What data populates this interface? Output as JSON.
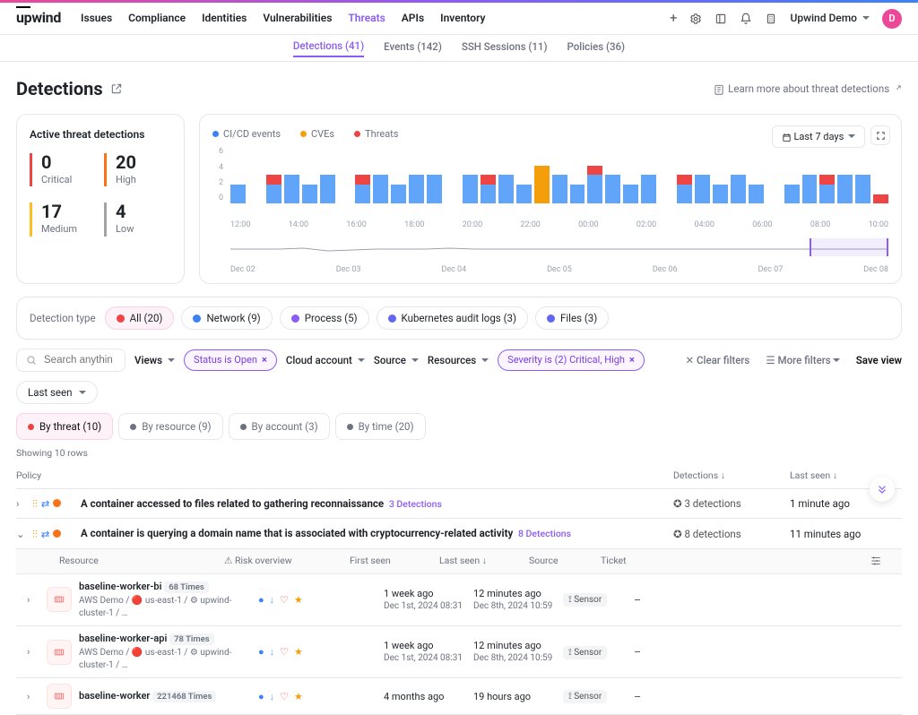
{
  "brand": "upwind",
  "nav": [
    "Issues",
    "Compliance",
    "Identities",
    "Vulnerabilities",
    "Threats",
    "APIs",
    "Inventory"
  ],
  "nav_active": 4,
  "workspace": {
    "name": "Upwind Demo",
    "avatar": "D"
  },
  "subnav": [
    {
      "label": "Detections",
      "count": 41,
      "active": true
    },
    {
      "label": "Events",
      "count": 142
    },
    {
      "label": "SSH Sessions",
      "count": 11
    },
    {
      "label": "Policies",
      "count": 36
    }
  ],
  "page_title": "Detections",
  "learn_more": "Learn more about threat detections",
  "stats": {
    "title": "Active threat detections",
    "items": [
      {
        "value": 0,
        "label": "Critical",
        "color": "#ef4444"
      },
      {
        "value": 20,
        "label": "High",
        "color": "#f97316"
      },
      {
        "value": 17,
        "label": "Medium",
        "color": "#fbbf24"
      },
      {
        "value": 4,
        "label": "Low",
        "color": "#a3a3a3"
      }
    ]
  },
  "chart_legend": [
    {
      "label": "CI/CD events",
      "color": "#3b82f6",
      "icon": "branch"
    },
    {
      "label": "CVEs",
      "color": "#f59e0b",
      "icon": "bug"
    },
    {
      "label": "Threats",
      "color": "#ef4444",
      "icon": "shield"
    }
  ],
  "timerange": "Last 7 days",
  "chart_data": {
    "type": "bar",
    "title": "",
    "xlabel": "",
    "ylabel": "",
    "ylim": [
      0,
      6
    ],
    "yticks": [
      0,
      2,
      4,
      6
    ],
    "x": [
      "12:00",
      "14:00",
      "16:00",
      "18:00",
      "20:00",
      "22:00",
      "00:00",
      "02:00",
      "04:00",
      "06:00",
      "08:00",
      "10:00"
    ],
    "brush_labels": [
      "Dec 02",
      "Dec 03",
      "Dec 04",
      "Dec 05",
      "Dec 06",
      "Dec 07",
      "Dec 08"
    ],
    "series": [
      {
        "name": "CI/CD events",
        "color": "#60a5fa",
        "values": [
          2,
          0,
          2,
          3,
          2,
          3,
          0,
          2,
          3,
          2,
          3,
          3,
          0,
          3,
          2,
          3,
          2,
          0,
          3,
          2,
          3,
          3,
          2,
          3,
          0,
          2,
          3,
          2,
          3,
          2,
          0,
          2,
          3,
          2,
          3,
          3,
          0
        ]
      },
      {
        "name": "CVEs",
        "color": "#f59e0b",
        "values": [
          0,
          0,
          0,
          0,
          0,
          0,
          0,
          0,
          0,
          0,
          0,
          0,
          0,
          0,
          0,
          0,
          0,
          4,
          0,
          0,
          0,
          0,
          0,
          0,
          0,
          0,
          0,
          0,
          0,
          0,
          0,
          0,
          0,
          0,
          0,
          0,
          0
        ]
      },
      {
        "name": "Threats",
        "color": "#ef4444",
        "values": [
          0,
          0,
          1,
          0,
          0,
          0,
          0,
          1,
          0,
          0,
          0,
          0,
          0,
          0,
          1,
          0,
          0,
          0,
          0,
          0,
          1,
          0,
          0,
          0,
          0,
          1,
          0,
          0,
          0,
          0,
          0,
          0,
          0,
          1,
          0,
          0,
          1
        ]
      }
    ],
    "brush_line": [
      12,
      12,
      12,
      11,
      14,
      13,
      12,
      12,
      12,
      11,
      12,
      12,
      12,
      12,
      12,
      12,
      12,
      12,
      12,
      12,
      12,
      12,
      12,
      12,
      12,
      12,
      12,
      12
    ]
  },
  "detection_type": {
    "label": "Detection type",
    "options": [
      {
        "label": "All",
        "count": 20,
        "active": true,
        "icon": "shield",
        "color": "#ef4444"
      },
      {
        "label": "Network",
        "count": 9,
        "icon": "swap",
        "color": "#3b82f6"
      },
      {
        "label": "Process",
        "count": 5,
        "icon": "gear",
        "color": "#8b5cf6"
      },
      {
        "label": "Kubernetes audit logs",
        "count": 3,
        "icon": "cube",
        "color": "#6366f1"
      },
      {
        "label": "Files",
        "count": 3,
        "icon": "file",
        "color": "#6366f1"
      }
    ]
  },
  "search_placeholder": "Search anything",
  "views_label": "Views",
  "filter_chips": [
    {
      "text": "Status is Open"
    },
    {
      "text": "Severity is (2) Critical, High"
    }
  ],
  "filter_dropdowns": [
    "Cloud account",
    "Source",
    "Resources"
  ],
  "actions": {
    "clear": "Clear filters",
    "more": "More filters",
    "save": "Save view"
  },
  "lastseen_pill": "Last seen",
  "group_tabs": [
    {
      "label": "By threat",
      "count": 10,
      "active": true,
      "icon": "shield",
      "color": "#ef4444"
    },
    {
      "label": "By resource",
      "count": 9,
      "icon": "cube",
      "color": "#6b7280"
    },
    {
      "label": "By account",
      "count": 3,
      "icon": "cloud",
      "color": "#6b7280"
    },
    {
      "label": "By time",
      "count": 20,
      "icon": "time",
      "color": "#6b7280"
    }
  ],
  "showing": "Showing 10 rows",
  "columns": {
    "policy": "Policy",
    "detections": "Detections",
    "lastseen": "Last seen"
  },
  "threats": [
    {
      "expanded": false,
      "severity": "#f97316",
      "title": "A container accessed to files related to gathering reconnaissance",
      "det_badge": "3 Detections",
      "det_count": "3 detections",
      "last": "1 minute ago"
    },
    {
      "expanded": true,
      "severity": "#f97316",
      "title": "A container is querying a domain name that is associated with cryptocurrency-related activity",
      "det_badge": "8 Detections",
      "det_count": "8 detections",
      "last": "11 minutes ago"
    }
  ],
  "subcolumns": {
    "resource": "Resource",
    "risk": "Risk overview",
    "first": "First seen",
    "last": "Last seen",
    "source": "Source",
    "ticket": "Ticket"
  },
  "resources": [
    {
      "name": "baseline-worker-bi",
      "times": "68 Times",
      "meta": "AWS Demo / 🔴 us-east-1 / ⚙ upwind-cluster-1 / …",
      "first": "1 week ago",
      "first_sub": "Dec 1st, 2024 08:31",
      "last": "12 minutes ago",
      "last_sub": "Dec 8th, 2024 10:59",
      "source": "Sensor",
      "ticket": "--"
    },
    {
      "name": "baseline-worker-api",
      "times": "78 Times",
      "meta": "AWS Demo / 🔴 us-east-1 / ⚙ upwind-cluster-1 / …",
      "first": "1 week ago",
      "first_sub": "Dec 1st, 2024 08:31",
      "last": "12 minutes ago",
      "last_sub": "Dec 8th, 2024 10:59",
      "source": "Sensor",
      "ticket": "--"
    },
    {
      "name": "baseline-worker",
      "times": "221468 Times",
      "meta": "",
      "first": "4 months ago",
      "first_sub": "",
      "last": "19 hours ago",
      "last_sub": "",
      "source": "Sensor",
      "ticket": "--"
    }
  ]
}
